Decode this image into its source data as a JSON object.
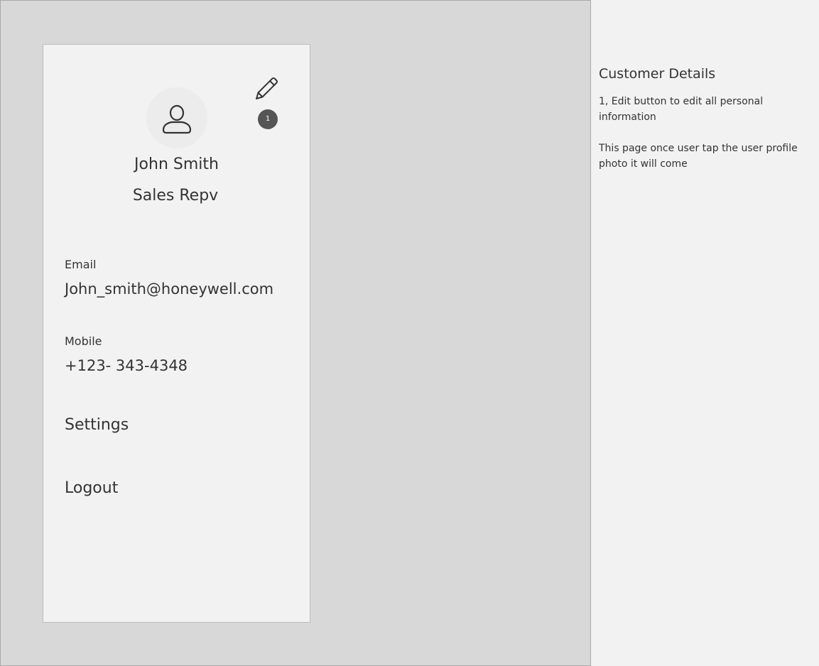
{
  "profile": {
    "name": "John Smith",
    "role": "Sales Repv",
    "edit_badge": "1"
  },
  "fields": {
    "email_label": "Email",
    "email_value": "John_smith@honeywell.com",
    "mobile_label": "Mobile",
    "mobile_value": "+123- 343-4348"
  },
  "menu": {
    "settings": "Settings",
    "logout": "Logout"
  },
  "notes": {
    "title": "Customer Details",
    "note_1": "1, Edit button to edit all personal information",
    "note_2": "This page once user tap the user profile photo it will come"
  },
  "icons": {
    "edit": "pencil-icon",
    "avatar": "user-icon"
  },
  "colors": {
    "artboard_bg": "#d8d8d8",
    "screen_bg": "#f2f2f2",
    "badge_bg": "#555555",
    "text": "#333333"
  }
}
